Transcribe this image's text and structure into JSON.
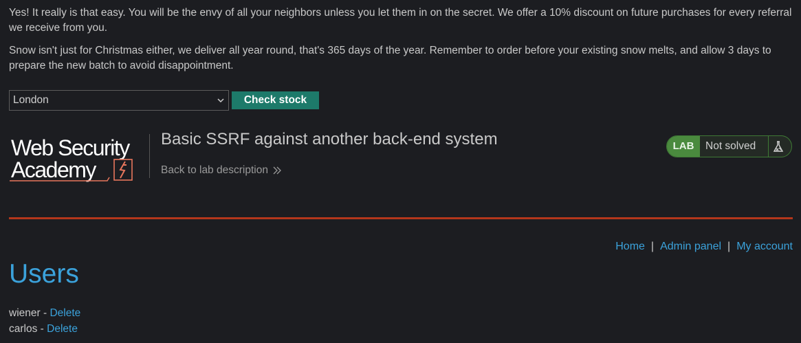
{
  "description": {
    "paragraph_1": "Yes! It really is that easy. You will be the envy of all your neighbors unless you let them in on the secret. We offer a 10% discount on future purchases for every referral we receive from you.",
    "paragraph_2": "Snow isn't just for Christmas either, we deliver all year round, that's 365 days of the year. Remember to order before your existing snow melts, and allow 3 days to prepare the new batch to avoid disappointment."
  },
  "stock": {
    "selected_store": "London",
    "check_button_label": "Check stock"
  },
  "header": {
    "logo_line1": "Web Security",
    "logo_line2": "Academy",
    "lab_title": "Basic SSRF against another back-end system",
    "back_link": "Back to lab description",
    "lab_tag": "LAB",
    "lab_status": "Not solved"
  },
  "nav": {
    "home": "Home",
    "admin_panel": "Admin panel",
    "my_account": "My account",
    "separator": "|"
  },
  "users": {
    "heading": "Users",
    "list": [
      {
        "name": "wiener",
        "dash": " - ",
        "action": "Delete"
      },
      {
        "name": "carlos",
        "dash": " - ",
        "action": "Delete"
      }
    ]
  },
  "colors": {
    "background": "#1c1d21",
    "accent_blue": "#3ba2db",
    "button_green": "#1d7a6a",
    "lab_green": "#4a8a3e",
    "rule_orange": "#b4361b",
    "logo_orange": "#e8765c"
  },
  "icons": {
    "select_chevron": "chevron-down-icon",
    "back_arrows": "double-chevron-right-icon",
    "lab_flask": "flask-icon",
    "logo_bolt": "lightning-bolt-icon"
  }
}
